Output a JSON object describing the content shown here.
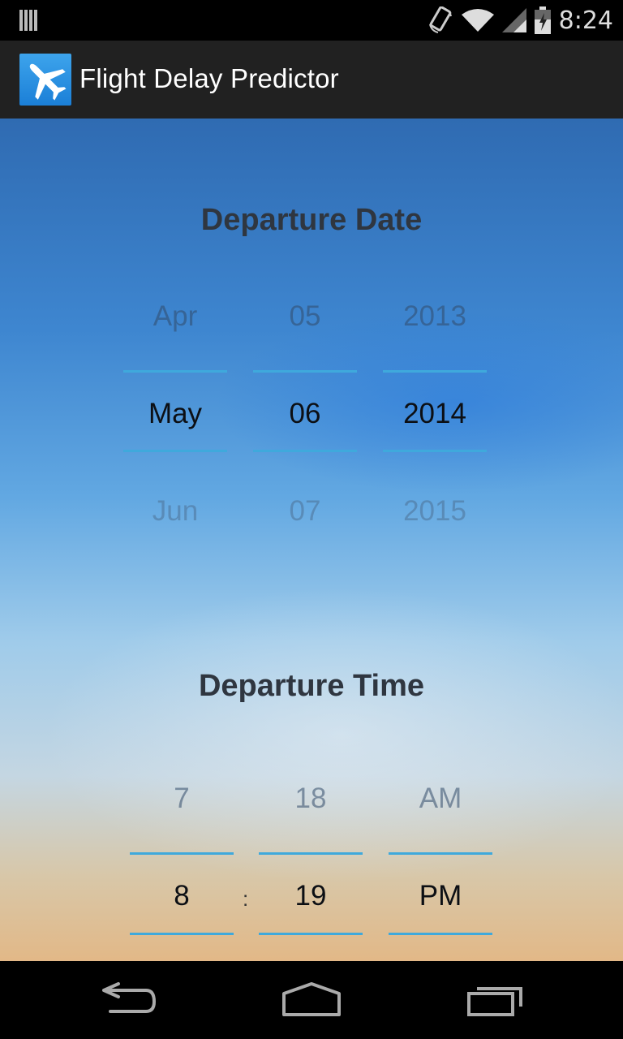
{
  "status_bar": {
    "time": "8:24",
    "icons": [
      "notification-bars-icon",
      "screen-rotation-icon",
      "wifi-icon",
      "signal-icon",
      "battery-icon"
    ]
  },
  "action_bar": {
    "app_icon": "airplane-icon",
    "title": "Flight Delay Predictor",
    "brand_color": "#1b7fd7"
  },
  "departure_date": {
    "title": "Departure Date",
    "month": {
      "prev": "Apr",
      "selected": "May",
      "next": "Jun"
    },
    "day": {
      "prev": "05",
      "selected": "06",
      "next": "07"
    },
    "year": {
      "prev": "2013",
      "selected": "2014",
      "next": "2015"
    }
  },
  "departure_time": {
    "title": "Departure Time",
    "hour": {
      "prev": "7",
      "selected": "8"
    },
    "separator": ":",
    "minute": {
      "prev": "18",
      "selected": "19"
    },
    "ampm": {
      "prev": "AM",
      "selected": "PM"
    }
  },
  "nav_bar": {
    "icons": [
      "back-icon",
      "home-icon",
      "recent-apps-icon"
    ]
  },
  "colors": {
    "divider": "#3fa9dc",
    "title_text": "#2f3640"
  }
}
